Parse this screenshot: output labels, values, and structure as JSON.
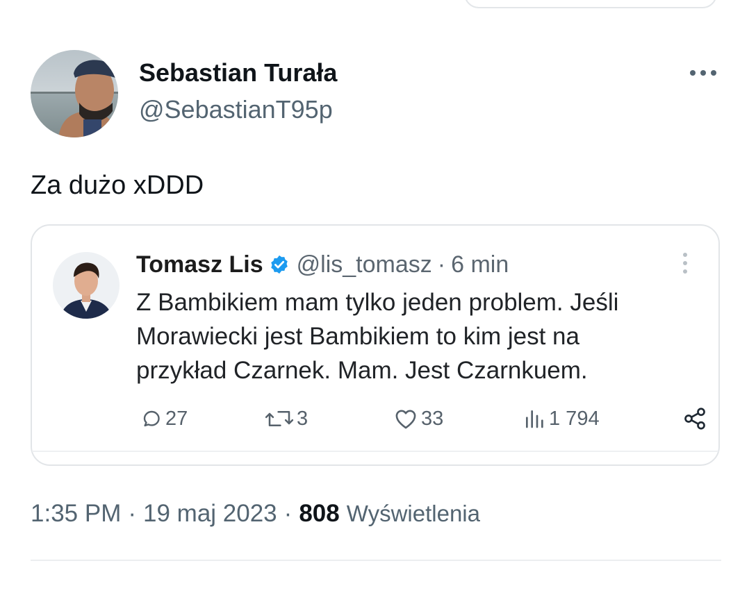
{
  "tweet": {
    "author": {
      "name": "Sebastian Turała",
      "handle": "@SebastianT95p",
      "avatar": "profile-photo"
    },
    "text": "Za dużo xDDD",
    "more_icon": "more-horizontal-icon",
    "timestamp": "1:35 PM",
    "separator": "·",
    "date": "19 maj 2023",
    "views_count": "808",
    "views_label": "Wyświetlenia"
  },
  "quote": {
    "author": {
      "name": "Tomasz Lis",
      "handle": "@lis_tomasz",
      "avatar": "profile-photo",
      "verified_icon": "verified-badge-icon"
    },
    "separator": "·",
    "time": "6 min",
    "more_icon": "more-vertical-icon",
    "text_lines": [
      "Z Bambikiem mam tylko jeden problem. Jeśli",
      "Morawiecki jest Bambikiem to kim jest na",
      "przykład Czarnek. Mam. Jest Czarnkuem."
    ],
    "actions": {
      "replies": "27",
      "retweets": "3",
      "likes": "33",
      "views": "1 794"
    }
  },
  "colors": {
    "text_primary": "#0f1419",
    "text_secondary": "#536471",
    "verified": "#1d9bf0",
    "border": "#e2e5e8"
  }
}
